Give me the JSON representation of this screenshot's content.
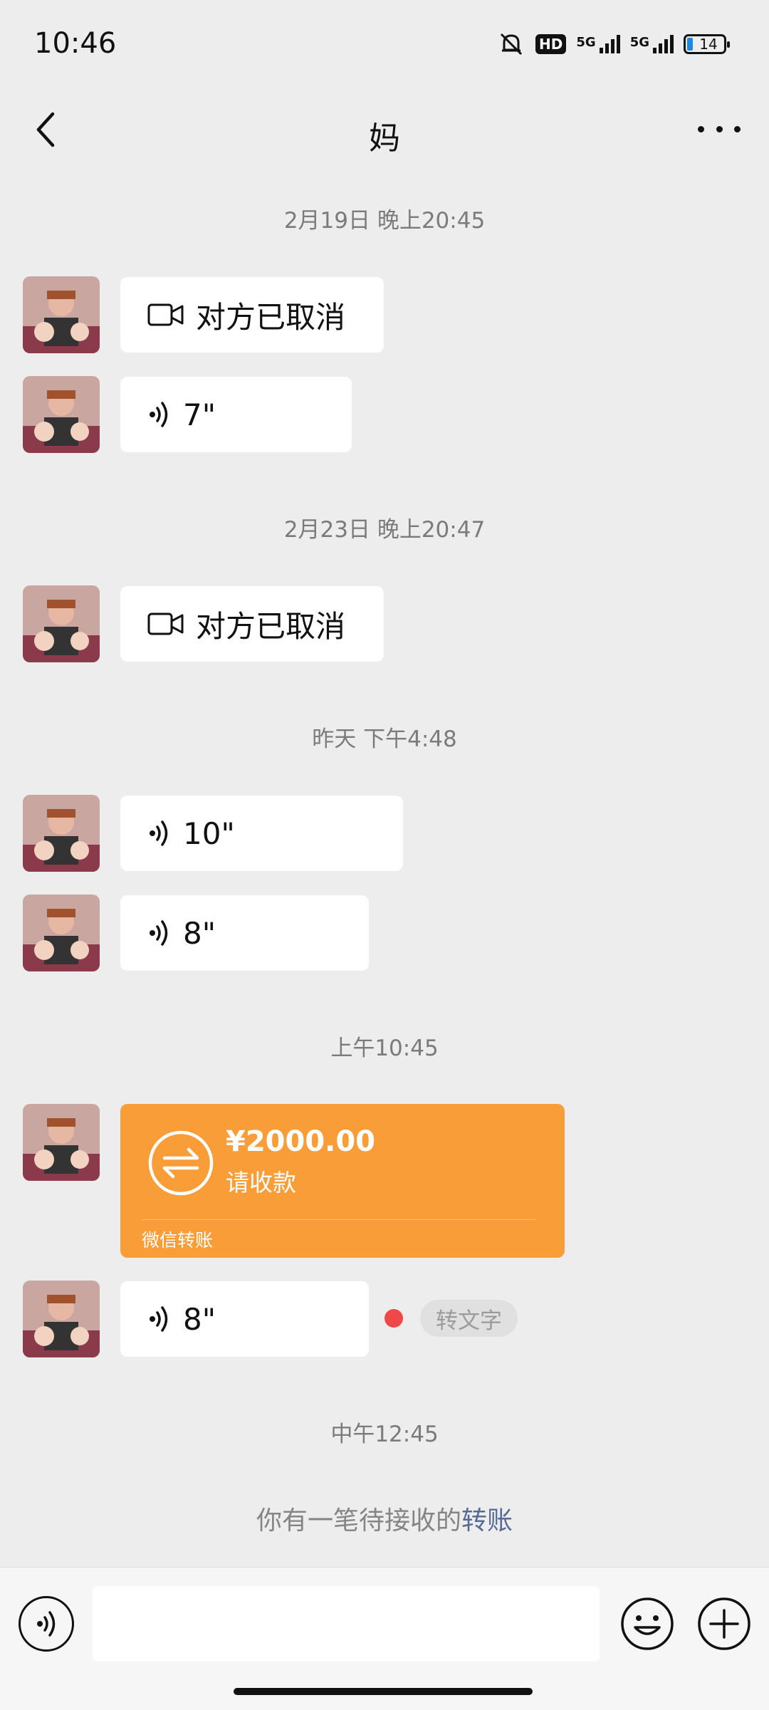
{
  "status_bar": {
    "time": "10:46",
    "hd_label": "HD",
    "network_1": "5G",
    "network_2": "5G",
    "battery_level": "14"
  },
  "header": {
    "title": "妈"
  },
  "messages": [
    {
      "timestamp": "2月19日 晚上20:45"
    },
    {
      "type": "video_call",
      "text": "对方已取消"
    },
    {
      "type": "voice",
      "duration": "7\""
    },
    {
      "timestamp": "2月23日 晚上20:47"
    },
    {
      "type": "video_call",
      "text": "对方已取消"
    },
    {
      "timestamp": "昨天 下午4:48"
    },
    {
      "type": "voice",
      "duration": "10\""
    },
    {
      "type": "voice",
      "duration": "8\""
    },
    {
      "timestamp": "上午10:45"
    },
    {
      "type": "transfer",
      "amount": "¥2000.00",
      "action": "请收款",
      "footer": "微信转账"
    },
    {
      "type": "voice",
      "duration": "8\"",
      "to_text": "转文字"
    },
    {
      "timestamp": "中午12:45"
    }
  ],
  "system_note": {
    "prefix": "你有一笔待接收的",
    "link": "转账"
  },
  "colors": {
    "background": "#ededed",
    "transfer": "#f89d38",
    "unread_dot": "#f04848",
    "link": "#576b95"
  },
  "icons": [
    "back-icon",
    "more-icon",
    "video-camera-icon",
    "voice-icon",
    "transfer-arrows-icon",
    "emoji-icon",
    "plus-icon"
  ]
}
